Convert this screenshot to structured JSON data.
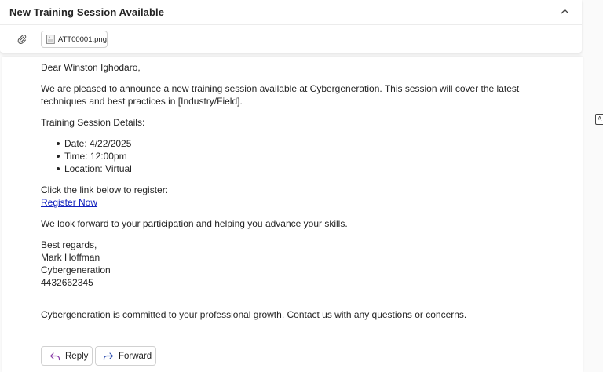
{
  "header": {
    "subject": "New Training Session Available",
    "attachment": {
      "filename": "ATT00001.png"
    }
  },
  "email": {
    "greeting": "Dear Winston Ighodaro,",
    "intro": "We are pleased to announce a new training session available at Cybergeneration. This session will cover the latest techniques and best practices in [Industry/Field].",
    "details_label": "Training Session Details:",
    "details": [
      "Date: 4/22/2025",
      "Time: 12:00pm",
      "Location: Virtual"
    ],
    "register_prompt": "Click the link below to register:",
    "register_link": "Register Now",
    "closing_line": "We look forward to your participation and helping you advance your skills.",
    "signature": {
      "sign_off": "Best regards,",
      "name": "Mark Hoffman",
      "company": "Cybergeneration",
      "phone": "4432662345"
    },
    "footer": "Cybergeneration is committed to your professional growth. Contact us with any questions or concerns."
  },
  "actions": {
    "reply_label": "Reply",
    "forward_label": "Forward"
  },
  "side_marker": "A",
  "colors": {
    "link": "#0f1fbd",
    "reply_icon": "#8a3fa8",
    "forward_icon": "#2f4fb0"
  },
  "icons": {
    "collapse": "chevron-up-icon",
    "attachment": "paperclip-icon",
    "file": "image-file-icon",
    "reply": "reply-arrow-icon",
    "forward": "forward-arrow-icon"
  }
}
